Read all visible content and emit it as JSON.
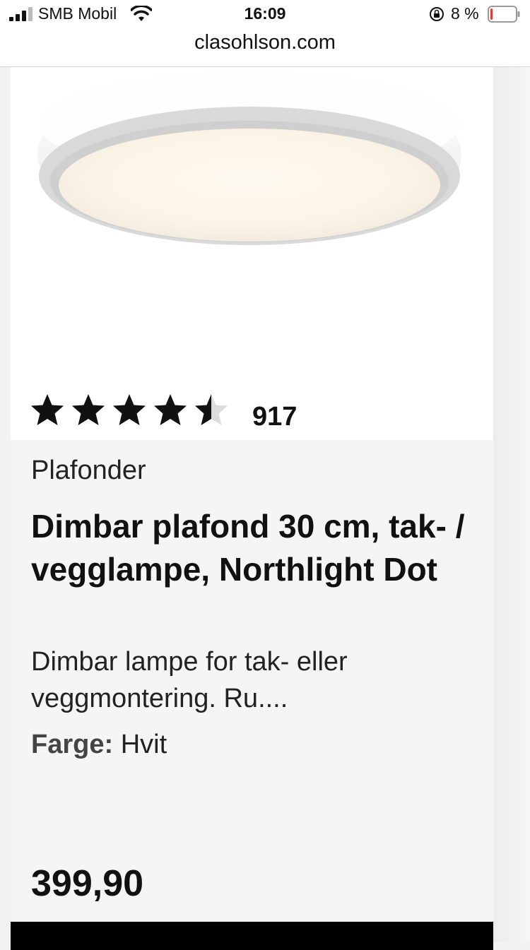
{
  "status_bar": {
    "carrier": "SMB Mobil",
    "time": "16:09",
    "battery_percent": "8 %",
    "battery_level": 0.08,
    "icons": [
      "signal-icon",
      "wifi-icon",
      "orientation-lock-icon",
      "battery-icon"
    ]
  },
  "browser": {
    "url": "clasohlson.com"
  },
  "product": {
    "image_icon": "ceiling-lamp-image",
    "rating": 4.5,
    "rating_max": 5,
    "review_count": "917",
    "category": "Plafonder",
    "title": "Dimbar plafond 30 cm, tak- / vegglampe, Northlight Dot",
    "description": "Dimbar lampe for tak- eller veggmontering. Ru....",
    "color_label": "Farge:",
    "color_value": "Hvit",
    "price": "399,90"
  },
  "colors": {
    "star": "#111111",
    "star_empty": "#dcdcdc",
    "battery_low": "#e53935",
    "buy_bar": "#000000"
  }
}
